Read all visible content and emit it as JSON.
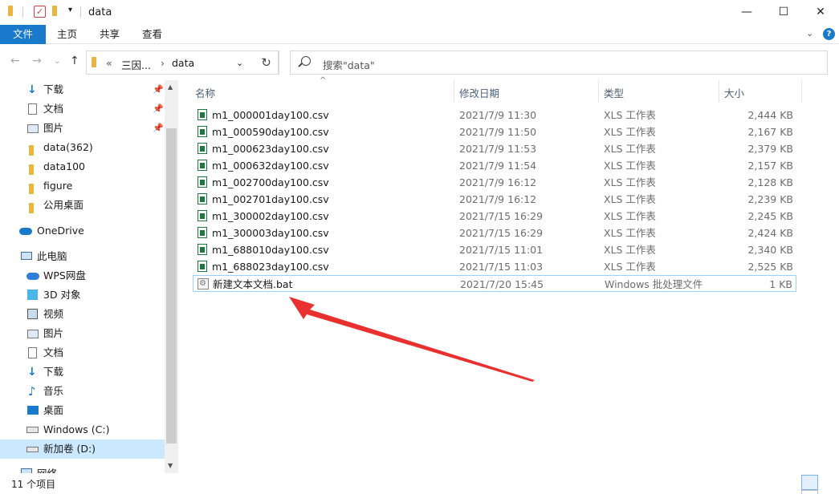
{
  "window": {
    "title": "data"
  },
  "ribbon": {
    "tabs": [
      "文件",
      "主页",
      "共享",
      "查看"
    ]
  },
  "address": {
    "parts": [
      "三因...",
      "data"
    ],
    "overflow": "«"
  },
  "search": {
    "placeholder": "搜索\"data\""
  },
  "sidebar": {
    "quick_access": [
      {
        "label": "下载",
        "icon": "download-icon",
        "pinned": true
      },
      {
        "label": "文档",
        "icon": "document-icon",
        "pinned": true
      },
      {
        "label": "图片",
        "icon": "picture-icon",
        "pinned": true
      },
      {
        "label": "data(362)",
        "icon": "folder-icon",
        "pinned": false
      },
      {
        "label": "data100",
        "icon": "folder-icon",
        "pinned": false
      },
      {
        "label": "figure",
        "icon": "folder-icon",
        "pinned": false
      },
      {
        "label": "公用桌面",
        "icon": "folder-icon",
        "pinned": false
      }
    ],
    "onedrive": "OneDrive",
    "this_pc": "此电脑",
    "pc_items": [
      {
        "label": "WPS网盘",
        "icon": "cloud-icon"
      },
      {
        "label": "3D 对象",
        "icon": "cube-icon"
      },
      {
        "label": "视频",
        "icon": "video-icon"
      },
      {
        "label": "图片",
        "icon": "picture-icon"
      },
      {
        "label": "文档",
        "icon": "document-icon"
      },
      {
        "label": "下载",
        "icon": "download-icon"
      },
      {
        "label": "音乐",
        "icon": "music-icon"
      },
      {
        "label": "桌面",
        "icon": "desktop-icon"
      },
      {
        "label": "Windows (C:)",
        "icon": "drive-icon"
      },
      {
        "label": "新加卷 (D:)",
        "icon": "drive-icon"
      }
    ],
    "partial_item": "网络"
  },
  "columns": {
    "name": "名称",
    "date": "修改日期",
    "type": "类型",
    "size": "大小"
  },
  "files": [
    {
      "name": "m1_000001day100.csv",
      "date": "2021/7/9 11:30",
      "type": "XLS 工作表",
      "size": "2,444 KB"
    },
    {
      "name": "m1_000590day100.csv",
      "date": "2021/7/9 11:50",
      "type": "XLS 工作表",
      "size": "2,167 KB"
    },
    {
      "name": "m1_000623day100.csv",
      "date": "2021/7/9 11:53",
      "type": "XLS 工作表",
      "size": "2,379 KB"
    },
    {
      "name": "m1_000632day100.csv",
      "date": "2021/7/9 11:54",
      "type": "XLS 工作表",
      "size": "2,157 KB"
    },
    {
      "name": "m1_002700day100.csv",
      "date": "2021/7/9 16:12",
      "type": "XLS 工作表",
      "size": "2,128 KB"
    },
    {
      "name": "m1_002701day100.csv",
      "date": "2021/7/9 16:12",
      "type": "XLS 工作表",
      "size": "2,239 KB"
    },
    {
      "name": "m1_300002day100.csv",
      "date": "2021/7/15 16:29",
      "type": "XLS 工作表",
      "size": "2,245 KB"
    },
    {
      "name": "m1_300003day100.csv",
      "date": "2021/7/15 16:29",
      "type": "XLS 工作表",
      "size": "2,424 KB"
    },
    {
      "name": "m1_688010day100.csv",
      "date": "2021/7/15 11:01",
      "type": "XLS 工作表",
      "size": "2,340 KB"
    },
    {
      "name": "m1_688023day100.csv",
      "date": "2021/7/15 11:03",
      "type": "XLS 工作表",
      "size": "2,525 KB"
    },
    {
      "name": "新建文本文档.bat",
      "date": "2021/7/20 15:45",
      "type": "Windows 批处理文件",
      "size": "1 KB"
    }
  ],
  "status": {
    "count": "11 个项目"
  },
  "colors": {
    "accent": "#1979ca",
    "arrow": "#e8312f",
    "selection": "#cce8ff"
  }
}
